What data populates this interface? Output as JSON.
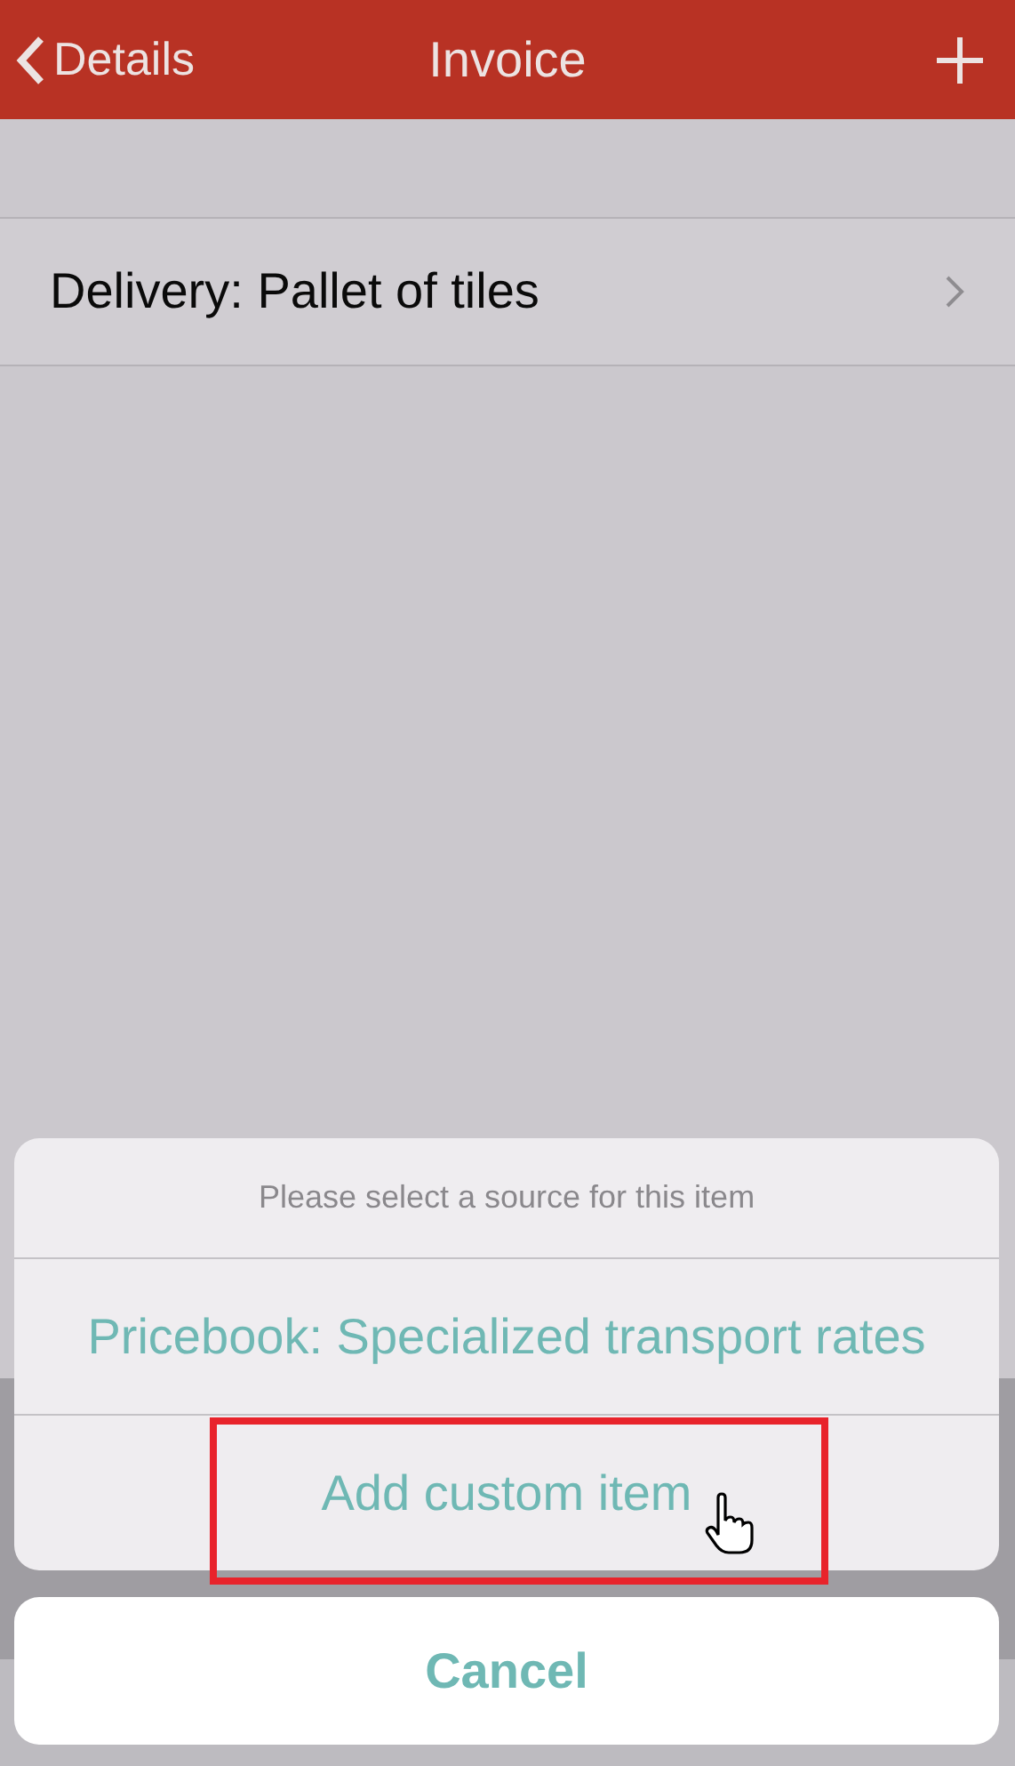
{
  "nav_bar": {
    "back_label": "Details",
    "title": "Invoice"
  },
  "line_items": [
    {
      "label": "Delivery: Pallet of tiles"
    }
  ],
  "action_sheet": {
    "message": "Please select a source for this item",
    "actions": [
      {
        "label": "Pricebook: Specialized transport rates",
        "highlighted": false
      },
      {
        "label": "Add custom item",
        "highlighted": true
      }
    ],
    "cancel": "Cancel"
  }
}
